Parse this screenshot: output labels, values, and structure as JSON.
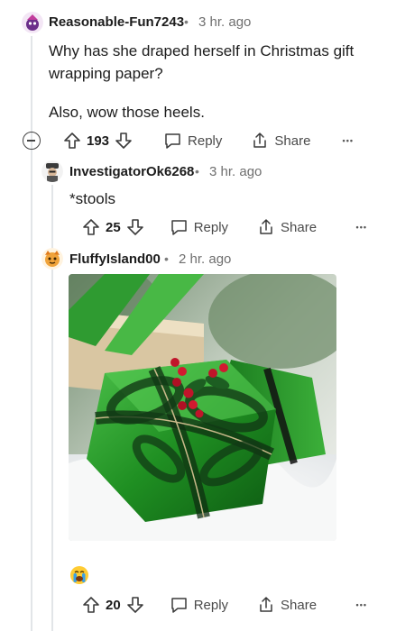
{
  "comments": [
    {
      "username": "Reasonable-Fun7243",
      "time": "3 hr. ago",
      "body_lines": [
        "Why has she draped herself in Christmas gift",
        "wrapping paper?"
      ],
      "body_extra": "Also, wow those heels.",
      "votes": "193",
      "reply_label": "Reply",
      "share_label": "Share"
    },
    {
      "username": "InvestigatorOk6268",
      "time": "3 hr. ago",
      "body": "*stools",
      "votes": "25",
      "reply_label": "Reply",
      "share_label": "Share"
    },
    {
      "username": "FluffyIsland00",
      "time": "2 hr. ago",
      "image_desc": "green-wrapped-gift-photo",
      "emoji": "crying-emoji",
      "votes": "20",
      "reply_label": "Reply",
      "share_label": "Share"
    }
  ],
  "separator": "•",
  "more_label": "•••",
  "colors": {
    "gift_green": "#2fa12f",
    "berry_red": "#c0142a",
    "line": "#e2e5e8"
  }
}
